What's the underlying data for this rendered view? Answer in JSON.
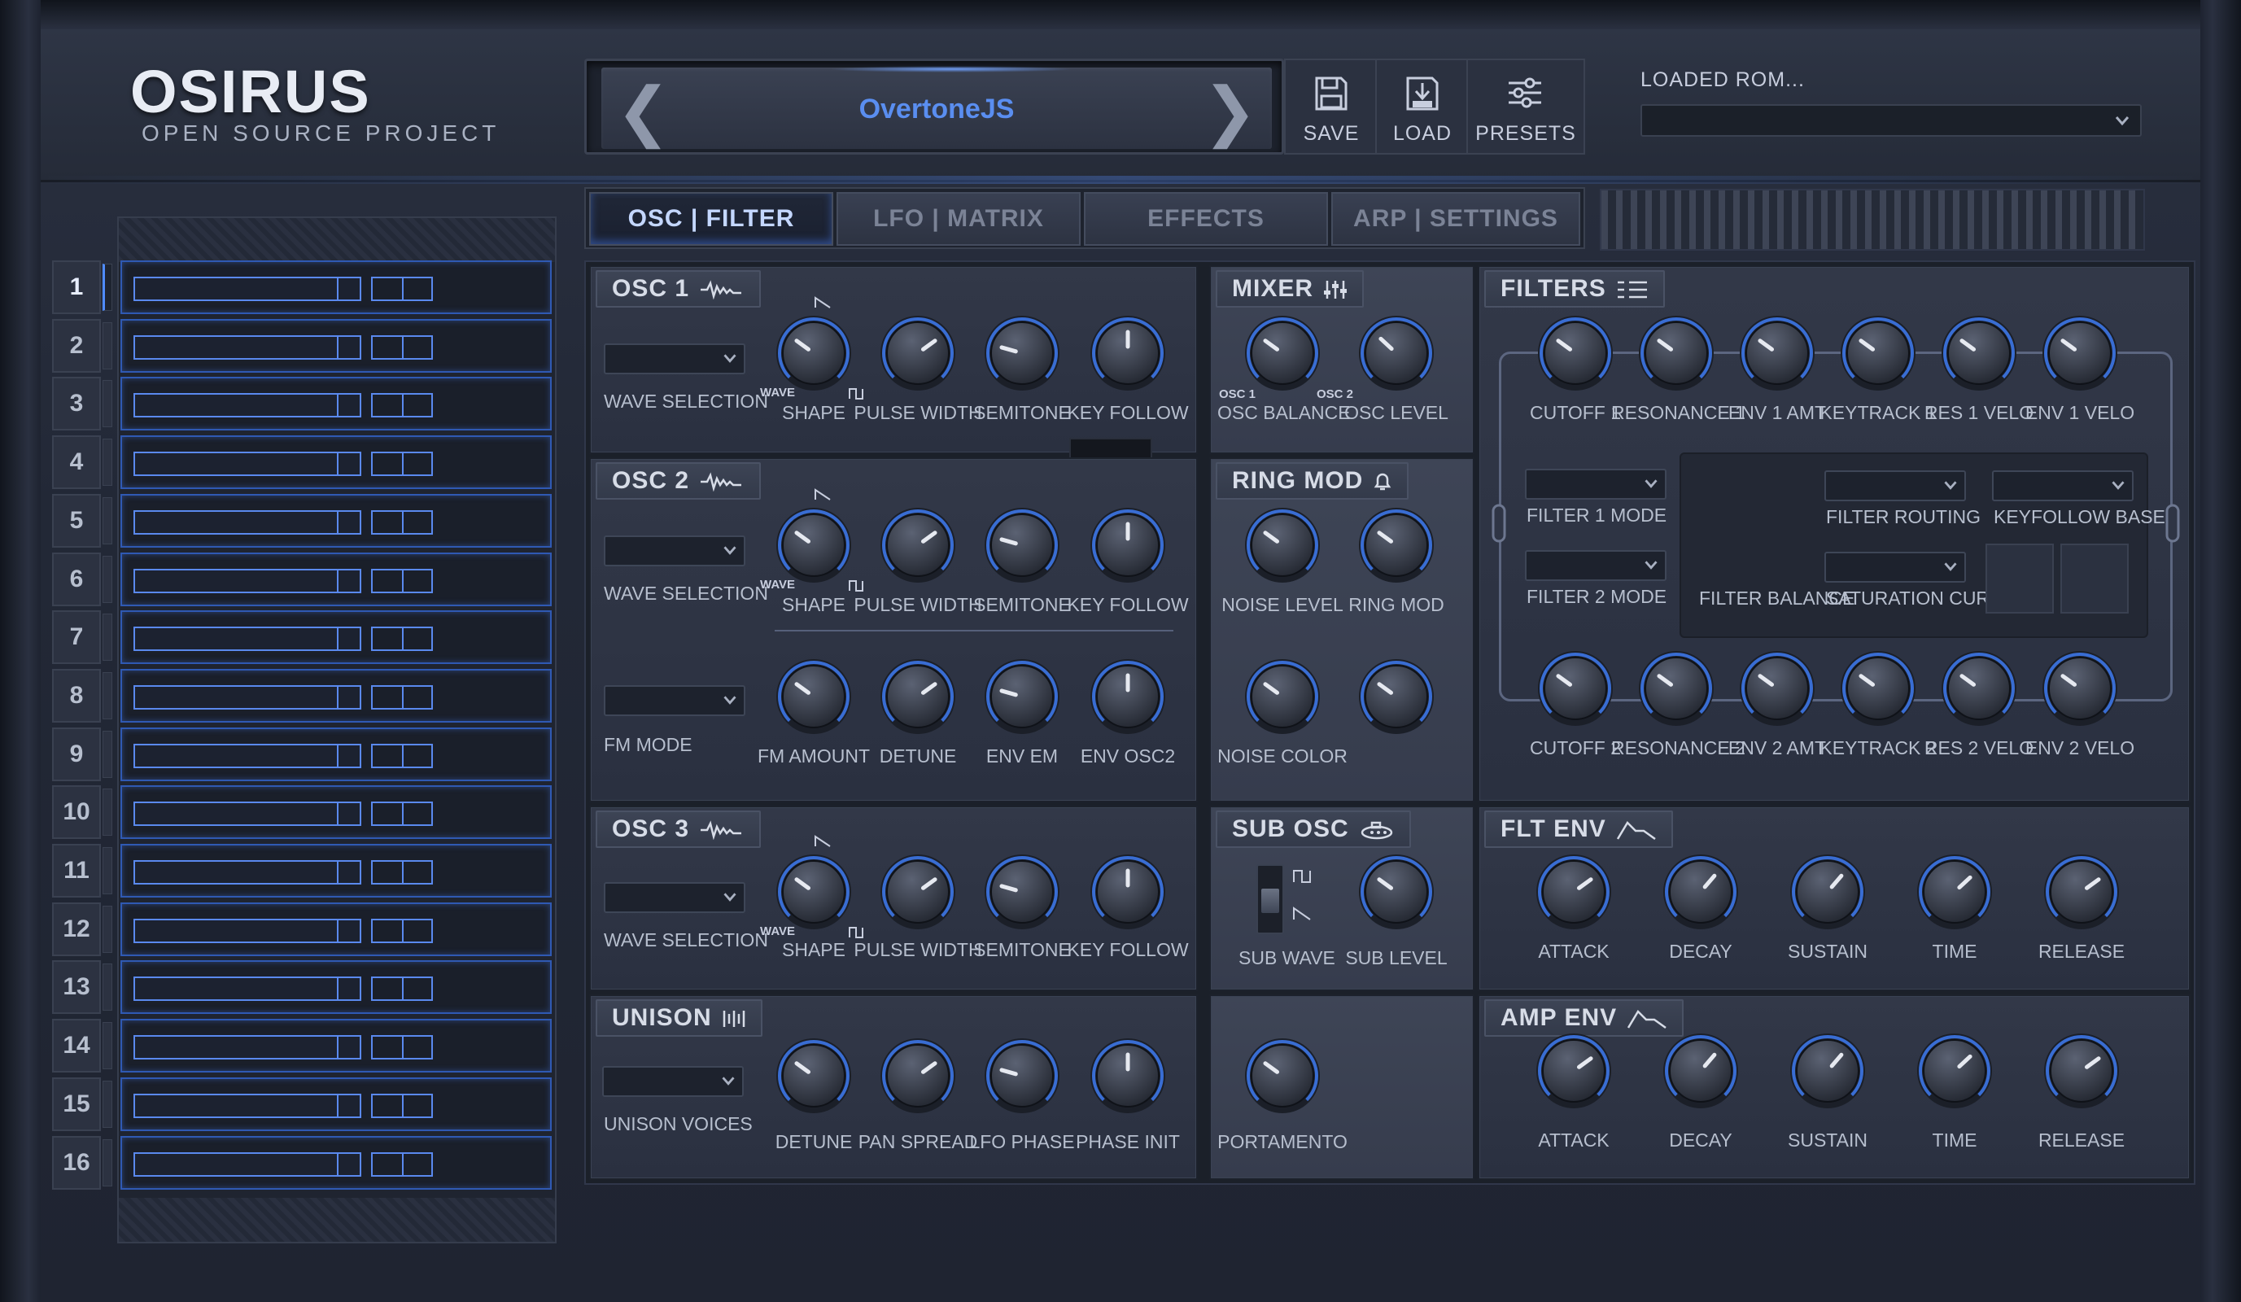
{
  "header": {
    "logo": "OSIRUS",
    "logo_sub": "OPEN SOURCE PROJECT",
    "preset_name": "OvertoneJS",
    "prev_glyph": "❮",
    "next_glyph": "❯",
    "tools": [
      {
        "label": "SAVE",
        "icon": "floppy-disk-icon"
      },
      {
        "label": "LOAD",
        "icon": "load-icon"
      },
      {
        "label": "PRESETS",
        "icon": "sliders-icon"
      }
    ],
    "rom_label": "LOADED ROM...",
    "rom_value": ""
  },
  "tabs": [
    {
      "label": "OSC  | FILTER",
      "active": true
    },
    {
      "label": "LFO  |  MATRIX",
      "active": false
    },
    {
      "label": "EFFECTS",
      "active": false
    },
    {
      "label": "ARP  |  SETTINGS",
      "active": false
    }
  ],
  "parts": [
    "1",
    "2",
    "3",
    "4",
    "5",
    "6",
    "7",
    "8",
    "9",
    "10",
    "11",
    "12",
    "13",
    "14",
    "15",
    "16"
  ],
  "selected_part": 1,
  "panels": {
    "osc1": {
      "title": "OSC 1",
      "wave_label": "WAVE SELECTION",
      "tiny_wave": "WAVE",
      "knobs": [
        {
          "label": "SHAPE",
          "value": -0.4
        },
        {
          "label": "PULSE WIDTH",
          "value": 0.4
        },
        {
          "label": "SEMITONE",
          "value": -0.55
        },
        {
          "label": "KEY FOLLOW",
          "value": 0
        }
      ]
    },
    "osc2": {
      "title": "OSC 2",
      "wave_label": "WAVE SELECTION",
      "tiny_wave": "WAVE",
      "fm_label": "FM MODE",
      "knobs": [
        {
          "label": "SHAPE",
          "value": -0.4
        },
        {
          "label": "PULSE WIDTH",
          "value": 0.4
        },
        {
          "label": "SEMITONE",
          "value": -0.55
        },
        {
          "label": "KEY FOLLOW",
          "value": 0
        }
      ],
      "knobs2": [
        {
          "label": "FM AMOUNT",
          "value": -0.4
        },
        {
          "label": "DETUNE",
          "value": 0.4
        },
        {
          "label": "ENV EM",
          "value": -0.55
        },
        {
          "label": "ENV OSC2",
          "value": 0
        }
      ]
    },
    "osc3": {
      "title": "OSC 3",
      "wave_label": "WAVE SELECTION",
      "tiny_wave": "WAVE",
      "knobs": [
        {
          "label": "SHAPE",
          "value": -0.4
        },
        {
          "label": "PULSE WIDTH",
          "value": 0.4
        },
        {
          "label": "SEMITONE",
          "value": -0.55
        },
        {
          "label": "KEY FOLLOW",
          "value": 0
        }
      ]
    },
    "unison": {
      "title": "UNISON",
      "voices_label": "UNISON VOICES",
      "knobs": [
        {
          "label": "DETUNE",
          "value": -0.4
        },
        {
          "label": "PAN SPREAD",
          "value": 0.4
        },
        {
          "label": "LFO PHASE",
          "value": -0.55
        },
        {
          "label": "PHASE INIT",
          "value": 0
        }
      ]
    },
    "mixer": {
      "title": "MIXER",
      "osc1": "OSC 1",
      "osc2": "OSC 2",
      "knobs": [
        {
          "label": "OSC BALANCE",
          "value": -0.4
        },
        {
          "label": "OSC LEVEL",
          "value": -0.35
        }
      ]
    },
    "ringmod": {
      "title": "RING MOD",
      "knobs": [
        {
          "label": "NOISE LEVEL",
          "value": -0.4
        },
        {
          "label": "RING MOD",
          "value": -0.4
        },
        {
          "label": "NOISE COLOR",
          "value": -0.4
        },
        {
          "label": "",
          "value": -0.4
        }
      ]
    },
    "subosc": {
      "title": "SUB OSC",
      "wave_label": "SUB WAVE",
      "knobs": [
        {
          "label": "SUB LEVEL",
          "value": -0.4
        }
      ]
    },
    "porta": {
      "knobs": [
        {
          "label": "PORTAMENTO",
          "value": -0.4
        }
      ]
    },
    "filters": {
      "title": "FILTERS",
      "knobs1": [
        {
          "label": "CUTOFF 1",
          "value": -0.4
        },
        {
          "label": "RESONANCE 1",
          "value": -0.4
        },
        {
          "label": "ENV 1 AMT",
          "value": -0.4
        },
        {
          "label": "KEYTRACK 1",
          "value": -0.4
        },
        {
          "label": "RES 1 VELO",
          "value": -0.4
        },
        {
          "label": "ENV 1 VELO",
          "value": -0.4
        }
      ],
      "knobs2": [
        {
          "label": "CUTOFF 2",
          "value": -0.4
        },
        {
          "label": "RESONANCE 2",
          "value": -0.4
        },
        {
          "label": "ENV 2 AMT",
          "value": -0.4
        },
        {
          "label": "KEYTRACK 2",
          "value": -0.4
        },
        {
          "label": "RES 2 VELO",
          "value": -0.4
        },
        {
          "label": "ENV 2 VELO",
          "value": -0.4
        }
      ],
      "filter1_mode": "FILTER 1 MODE",
      "filter2_mode": "FILTER 2 MODE",
      "routing": "FILTER ROUTING",
      "keyfollow": "KEYFOLLOW BASE",
      "balance": "FILTER BALANCE",
      "saturation": "SATURATION CURVE"
    },
    "fltenv": {
      "title": "FLT  ENV",
      "knobs": [
        {
          "label": "ATTACK",
          "value": 0.4
        },
        {
          "label": "DECAY",
          "value": 0.3
        },
        {
          "label": "SUSTAIN",
          "value": 0.3
        },
        {
          "label": "TIME",
          "value": 0.35
        },
        {
          "label": "RELEASE",
          "value": 0.4
        }
      ]
    },
    "ampenv": {
      "title": "AMP ENV",
      "knobs": [
        {
          "label": "ATTACK",
          "value": 0.4
        },
        {
          "label": "DECAY",
          "value": 0.3
        },
        {
          "label": "SUSTAIN",
          "value": 0.3
        },
        {
          "label": "TIME",
          "value": 0.35
        },
        {
          "label": "RELEASE",
          "value": 0.4
        }
      ]
    }
  },
  "colors": {
    "accent": "#4f8cff",
    "knob_ring": "#3d76e6",
    "preset_text": "#5a8ef0"
  }
}
